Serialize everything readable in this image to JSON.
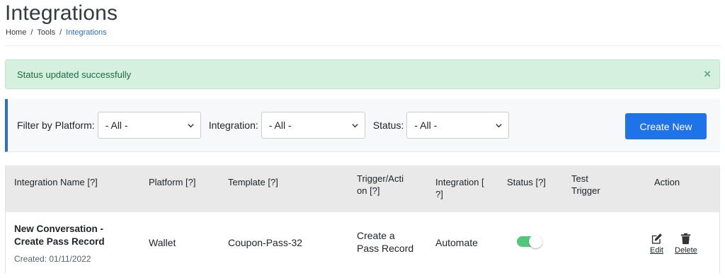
{
  "page": {
    "title": "Integrations",
    "breadcrumb": [
      "Home",
      "Tools",
      "Integrations"
    ],
    "breadcrumb_separator": "/"
  },
  "alert": {
    "message": "Status updated successfully",
    "close_icon": "×"
  },
  "filters": {
    "platform_label": "Filter by Platform:",
    "platform_value": "- All -",
    "integration_label": "Integration:",
    "integration_value": "- All -",
    "status_label": "Status:",
    "status_value": "- All -",
    "create_button": "Create New"
  },
  "table": {
    "headers": {
      "name": "Integration Name [?]",
      "platform": "Platform [?]",
      "template": "Template [?]",
      "trigger_line1": "Trigger/Acti",
      "trigger_line2": "on [?]",
      "integration_line1": "Integration [",
      "integration_line2": "?]",
      "status": "Status [?]",
      "test_line1": "Test",
      "test_line2": "Trigger",
      "action": "Action"
    },
    "rows": [
      {
        "name_line1": "New Conversation -",
        "name_line2": "Create Pass Record",
        "created": "Created: 01/11/2022",
        "platform": "Wallet",
        "template": "Coupon-Pass-32",
        "trigger_line1": "Create a",
        "trigger_line2": "Pass Record",
        "integration": "Automate",
        "status_on": true,
        "edit_label": "Edit",
        "delete_label": "Delete"
      }
    ]
  },
  "colors": {
    "primary": "#1f73e8",
    "alert_bg": "#d6f0e0",
    "alert_text": "#1e6b3a",
    "toggle_on": "#51c77a",
    "header_bg": "#e9e9e9"
  },
  "icons": {
    "dropdown": "chevron-down-icon",
    "edit": "edit-icon",
    "delete": "trash-icon",
    "close": "close-icon"
  }
}
